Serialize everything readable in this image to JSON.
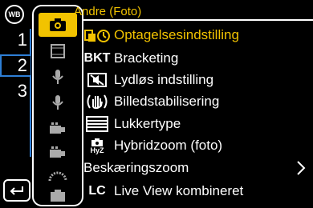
{
  "menu": {
    "title": "Andre (Foto)",
    "items": [
      {
        "icon": "selftimer-icon",
        "label": "Optagelsesindstilling",
        "selected": true
      },
      {
        "icon_text": "BKT",
        "label": "Bracketing"
      },
      {
        "icon": "silent-mode-icon",
        "label": "Lydløs indstilling"
      },
      {
        "icon": "stabilizer-hand-icon",
        "label": "Billedstabilisering"
      },
      {
        "icon": "shutter-type-icon",
        "label": "Lukkertype"
      },
      {
        "icon_text": "HyZ",
        "icon": "camera-hybrid-zoom-icon",
        "label": "Hybridzoom (foto)"
      },
      {
        "label": "Beskæringszoom",
        "has_submenu": true
      },
      {
        "icon_text": "LC",
        "label": "Live View kombineret"
      }
    ]
  },
  "left": {
    "wb_label": "WB",
    "page_tabs": [
      "1",
      "2",
      "3"
    ],
    "active_page": "2"
  },
  "icon_column": [
    {
      "name": "camera-photo-icon",
      "active": true
    },
    {
      "name": "film-video-icon"
    },
    {
      "name": "microphone-icon"
    },
    {
      "name": "microphone-icon"
    },
    {
      "name": "video-camera-icon"
    },
    {
      "name": "video-camera-icon"
    },
    {
      "name": "lens-gauge-icon"
    },
    {
      "name": "camera-body-icon"
    }
  ],
  "colors": {
    "accent": "#f2c300",
    "tab_border": "#2e7fd6",
    "text": "#ffffff",
    "background": "#000000"
  }
}
